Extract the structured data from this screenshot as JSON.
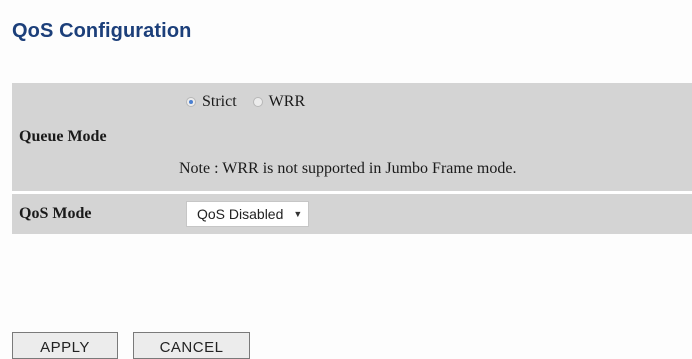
{
  "page": {
    "title": "QoS Configuration"
  },
  "queue_mode": {
    "label": "Queue Mode",
    "options": [
      {
        "label": "Strict",
        "checked": true
      },
      {
        "label": "WRR",
        "checked": false
      }
    ],
    "note": "Note : WRR is not supported in Jumbo Frame mode."
  },
  "qos_mode": {
    "label": "QoS Mode",
    "selected": "QoS Disabled"
  },
  "buttons": {
    "apply": "APPLY",
    "cancel": "CANCEL"
  },
  "colors": {
    "title": "#1c3f7a",
    "table_bg": "#d4d4d4",
    "radio_selected": "#4a7fd0"
  }
}
